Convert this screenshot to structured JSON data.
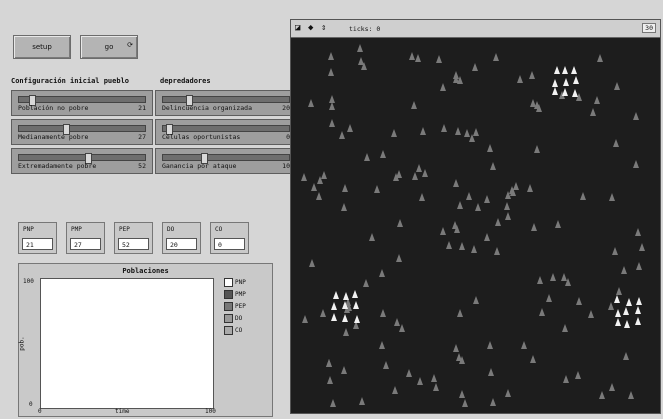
{
  "buttons": {
    "setup": "setup",
    "go": "go"
  },
  "sections": {
    "left": "Configuración inicial pueblo",
    "right": "depredadores"
  },
  "sliders_left": [
    {
      "label": "Población no pobre",
      "value": "21",
      "fraction": 0.08
    },
    {
      "label": "Medianamente pobre",
      "value": "27",
      "fraction": 0.35
    },
    {
      "label": "Extremadamente pobre",
      "value": "52",
      "fraction": 0.52
    }
  ],
  "sliders_right": [
    {
      "label": "Delincuencia organizada",
      "value": "20",
      "fraction": 0.18
    },
    {
      "label": "Células oportunistas",
      "value": "0",
      "fraction": 0.02
    },
    {
      "label": "Ganancia por ataque",
      "value": "10",
      "fraction": 0.3
    }
  ],
  "monitors": [
    {
      "label": "PNP",
      "value": "21"
    },
    {
      "label": "PMP",
      "value": "27"
    },
    {
      "label": "PEP",
      "value": "52"
    },
    {
      "label": "DO",
      "value": "20"
    },
    {
      "label": "CO",
      "value": "0"
    }
  ],
  "plot": {
    "title": "Poblaciones",
    "ylabel": "pob.",
    "xlabel": "time",
    "y_max": "100",
    "y_min": "0",
    "x_min": "0",
    "x_max": "100",
    "legend": [
      {
        "name": "PNP",
        "color": "#ffffff"
      },
      {
        "name": "PMP",
        "color": "#555555"
      },
      {
        "name": "PEP",
        "color": "#777777"
      },
      {
        "name": "DO",
        "color": "#999999"
      },
      {
        "name": "CO",
        "color": "#aaaaaa"
      }
    ]
  },
  "world": {
    "ticks_label": "ticks: 0",
    "speed_label": "30"
  }
}
